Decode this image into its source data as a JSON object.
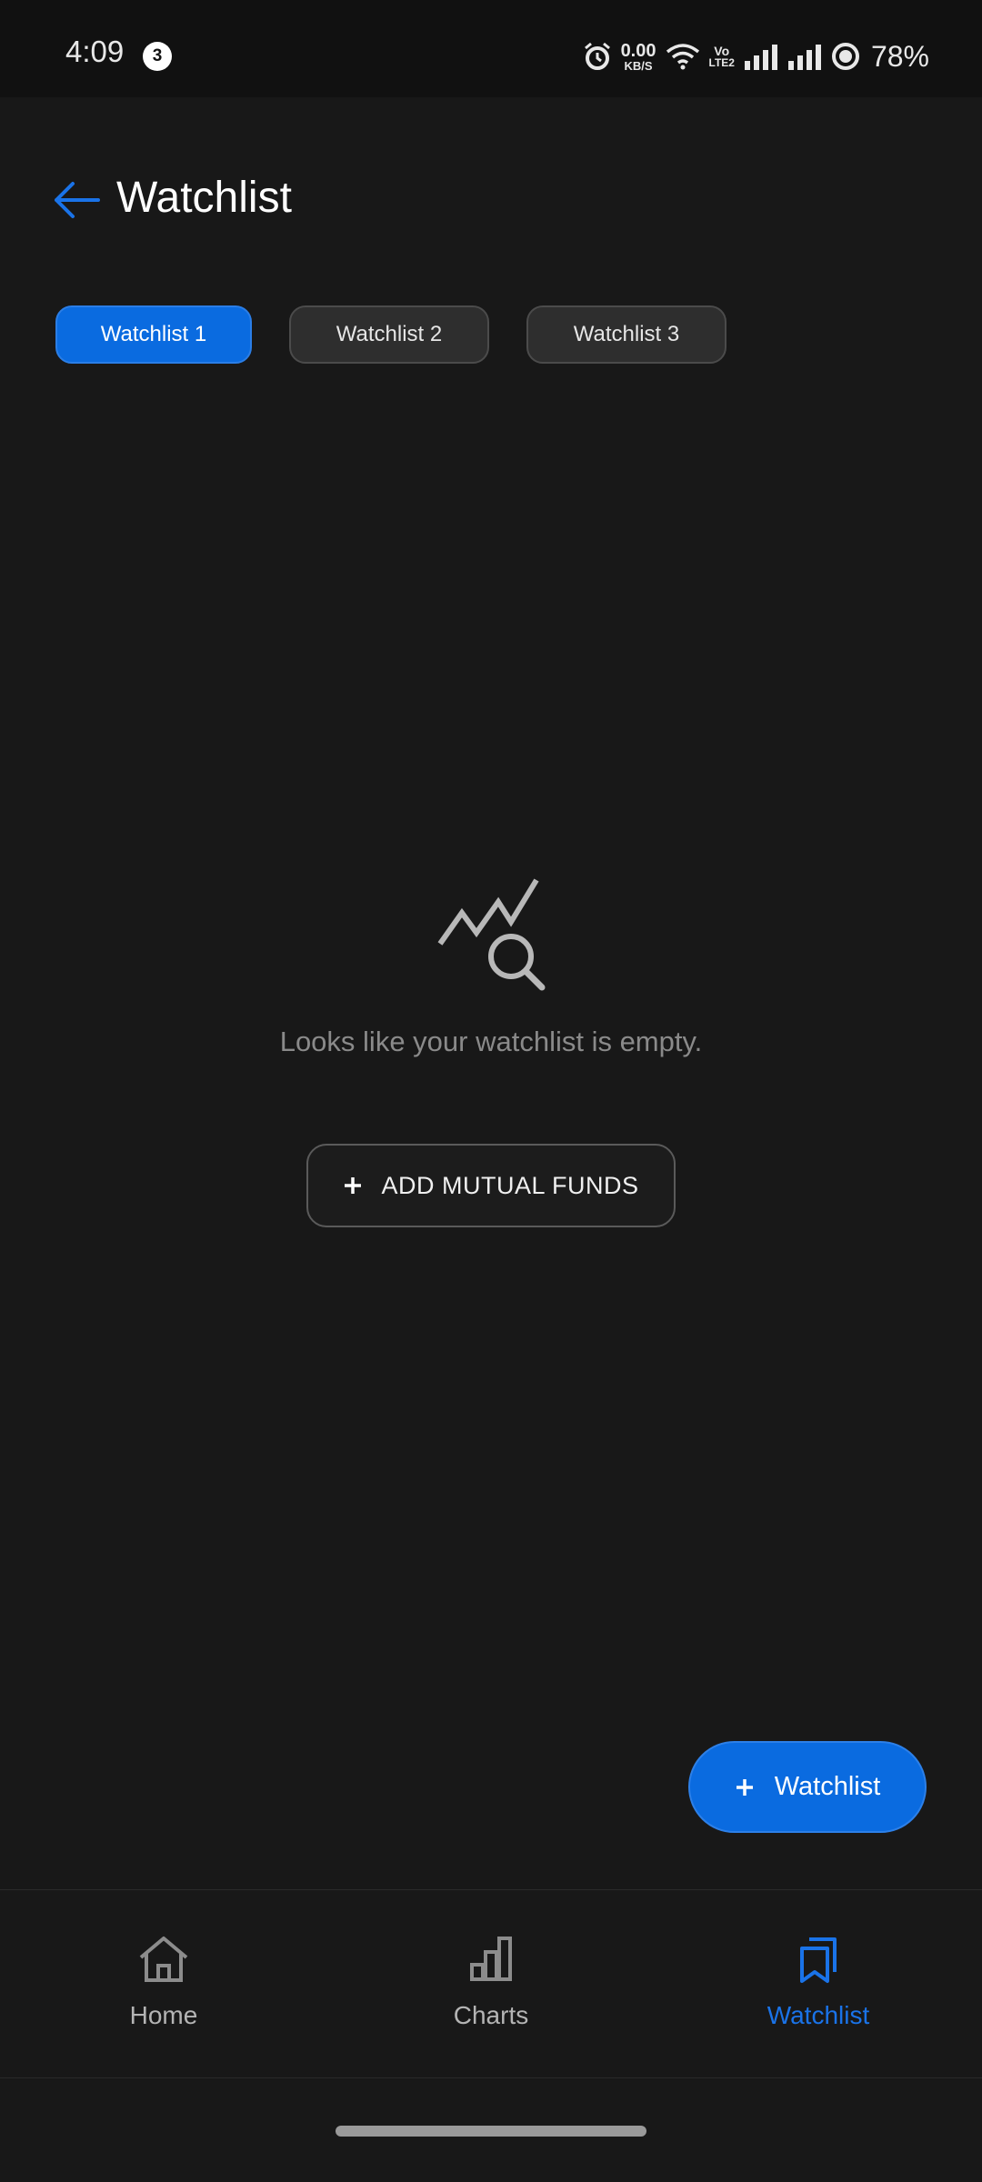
{
  "status_bar": {
    "time": "4:09",
    "notification_count": "3",
    "net_speed_value": "0.00",
    "net_speed_unit": "KB/S",
    "volte_top": "Vo",
    "volte_bottom": "LTE2",
    "battery": "78%",
    "icons": [
      "alarm-icon",
      "wifi-icon",
      "signal-icon",
      "signal-icon",
      "battery-icon"
    ]
  },
  "header": {
    "title": "Watchlist",
    "back_icon": "arrow-left-icon"
  },
  "tabs": [
    {
      "label": "Watchlist 1",
      "active": true
    },
    {
      "label": "Watchlist 2",
      "active": false
    },
    {
      "label": "Watchlist 3",
      "active": false
    }
  ],
  "empty_state": {
    "icon": "chart-search-icon",
    "message": "Looks like your watchlist is empty.",
    "action_label": "ADD MUTUAL FUNDS",
    "action_icon": "plus-icon"
  },
  "fab": {
    "label": "Watchlist",
    "icon": "plus-icon"
  },
  "bottom_nav": {
    "items": [
      {
        "label": "Home",
        "icon": "home-icon",
        "active": false
      },
      {
        "label": "Charts",
        "icon": "bar-chart-icon",
        "active": false
      },
      {
        "label": "Watchlist",
        "icon": "bookmark-icon",
        "active": true
      }
    ]
  },
  "colors": {
    "background": "#181818",
    "status_bar": "#111111",
    "accent": "#0a6be0",
    "muted_text": "#8a8a8a",
    "inactive_tab": "#2e2e2e"
  }
}
